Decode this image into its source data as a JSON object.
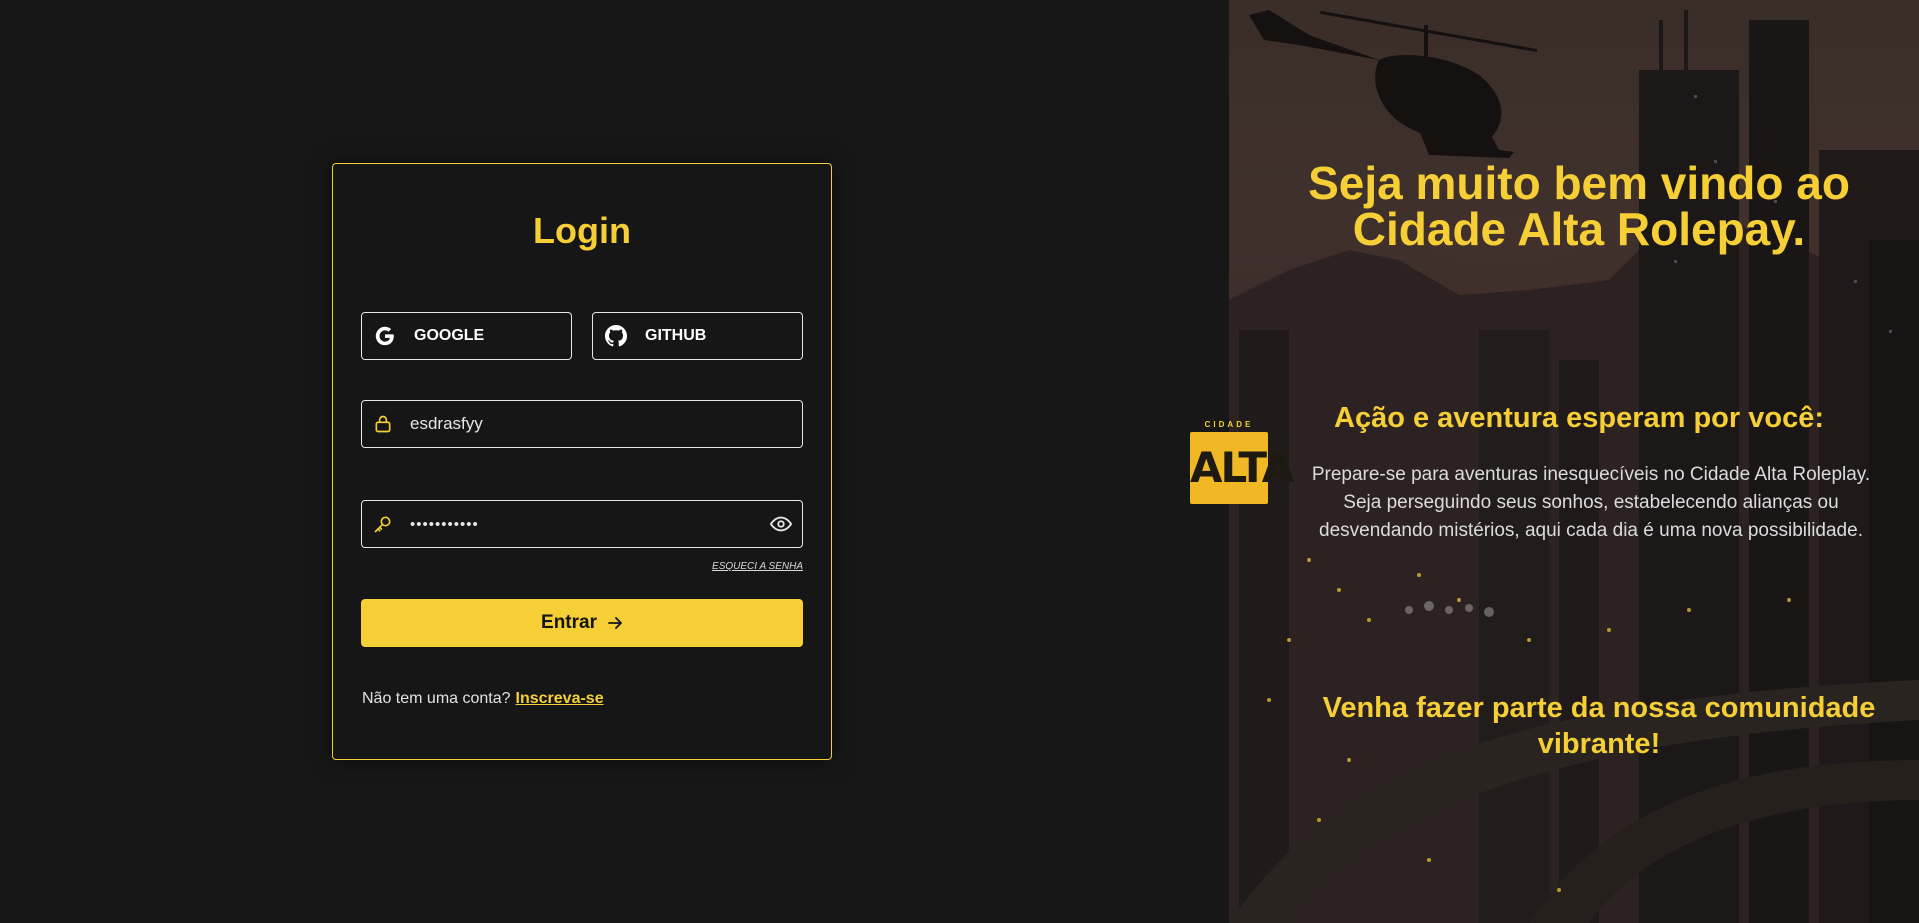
{
  "login_card": {
    "title": "Login",
    "social": {
      "google_label": "GOOGLE",
      "github_label": "GITHUB"
    },
    "username": {
      "value": "esdrasfyy"
    },
    "password": {
      "value": "•••••••••••"
    },
    "forgot_label": "ESQUECI A SENHA",
    "submit_label": "Entrar",
    "signup": {
      "prompt": "Não tem uma conta?",
      "link": "Inscreva-se"
    }
  },
  "promo": {
    "hero_title": "Seja muito bem vindo ao Cidade Alta Rolepay.",
    "subtitle": "Ação e aventura esperam por você:",
    "description": "Prepare-se para aventuras inesquecíveis no Cidade Alta Roleplay. Seja perseguindo seus sonhos, estabelecendo alianças ou desvendando mistérios, aqui cada dia é uma nova possibilidade.",
    "join_text": "Venha fazer parte da nossa comunidade vibrante!"
  },
  "logo": {
    "top_text": "CIDADE",
    "main_text": "ALTA"
  },
  "colors": {
    "accent": "#f5cf35",
    "background": "#171717",
    "text_light": "#e6e6e6"
  },
  "icons": [
    "google-icon",
    "github-icon",
    "lock-icon",
    "key-icon",
    "eye-icon",
    "arrow-right-icon"
  ]
}
